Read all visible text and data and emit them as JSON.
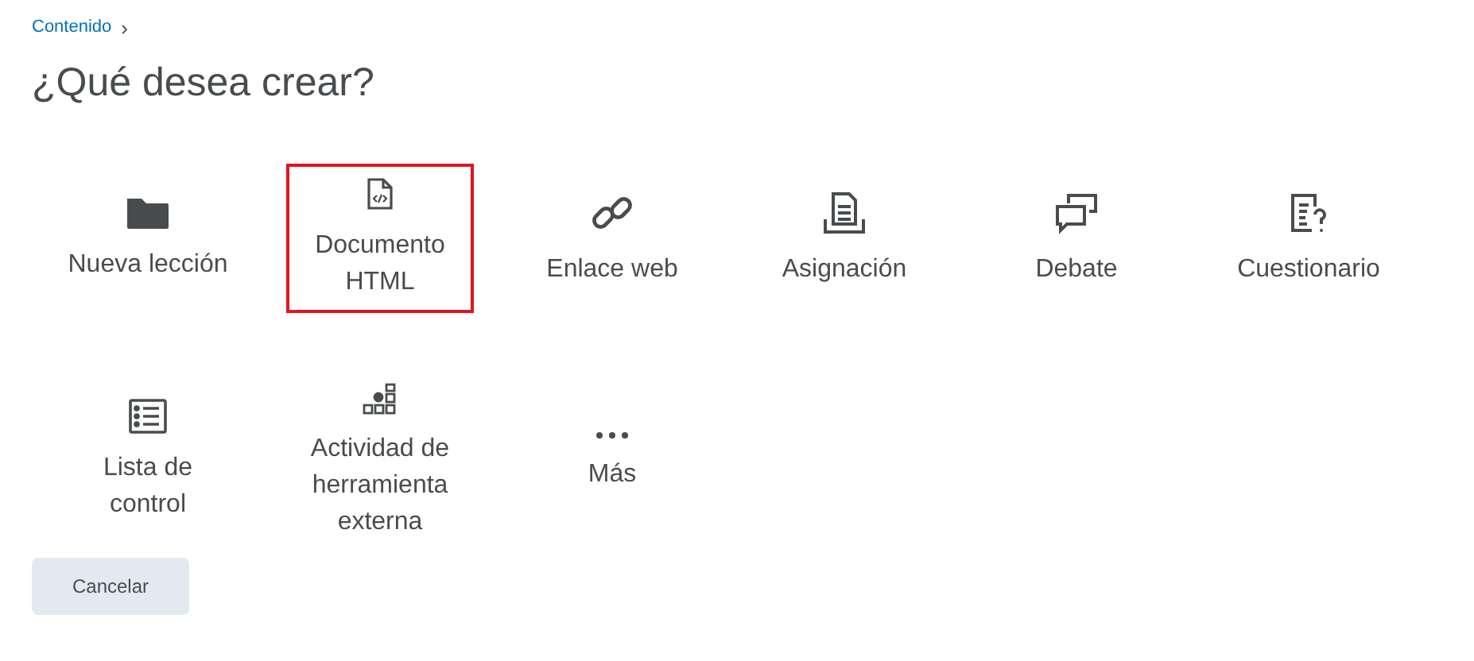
{
  "breadcrumb": {
    "link": "Contenido",
    "separator": "›"
  },
  "title": "¿Qué desea crear?",
  "items": [
    {
      "kind": "folder",
      "label": "Nueva lección",
      "highlighted": false
    },
    {
      "kind": "html",
      "label": "Documento HTML",
      "highlighted": true
    },
    {
      "kind": "link",
      "label": "Enlace web",
      "highlighted": false
    },
    {
      "kind": "assignment",
      "label": "Asignación",
      "highlighted": false
    },
    {
      "kind": "discussion",
      "label": "Debate",
      "highlighted": false
    },
    {
      "kind": "quiz",
      "label": "Cuestionario",
      "highlighted": false
    },
    {
      "kind": "checklist",
      "label": "Lista de control",
      "highlighted": false
    },
    {
      "kind": "external",
      "label": "Actividad de herramienta externa",
      "highlighted": false
    },
    {
      "kind": "more",
      "label": "Más",
      "highlighted": false
    }
  ],
  "cancel_button": "Cancelar"
}
